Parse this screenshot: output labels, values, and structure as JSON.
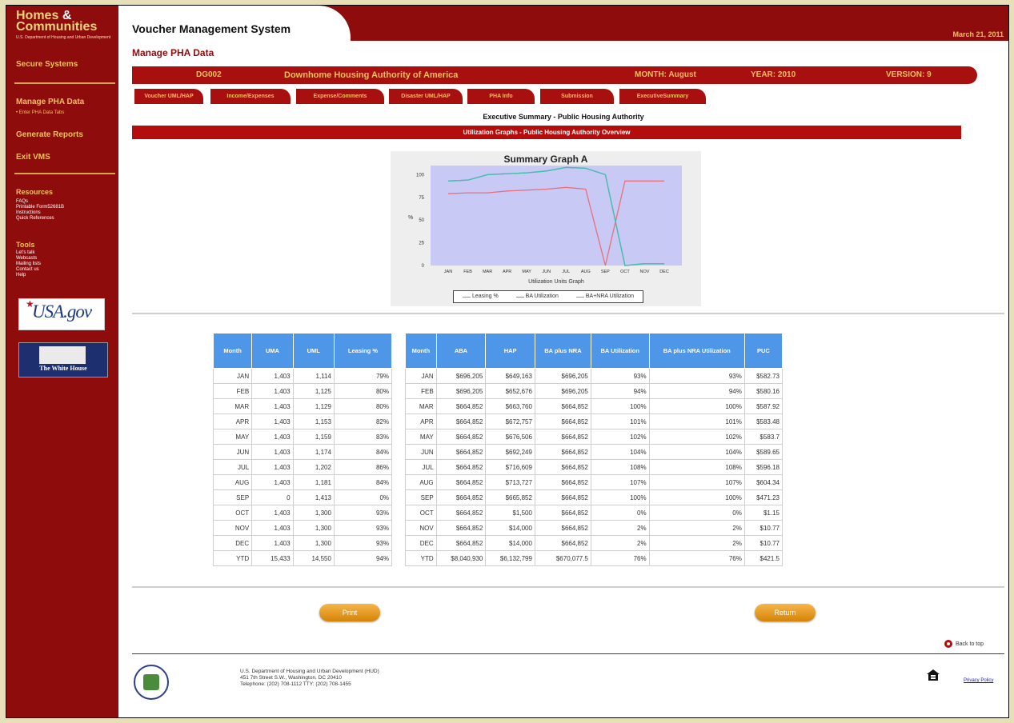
{
  "sidebar": {
    "logo_line1": "Homes",
    "logo_amp": "&",
    "logo_line2": "Communities",
    "logo_sub": "U.S. Department of Housing and Urban Development",
    "secure_systems": "Secure Systems",
    "manage_pha": "Manage PHA Data",
    "enter_pha_tabs": "• Enter PHA Data Tabs",
    "generate_reports": "Generate Reports",
    "exit_vms": "Exit VMS",
    "resources_heading": "Resources",
    "resources": [
      "FAQs",
      "Printable Form52681B",
      "Instructions",
      "Quick References"
    ],
    "tools_heading": "Tools",
    "tools": [
      "Let's talk",
      "Webcasts",
      "Mailing lists",
      "Contact us",
      "Help"
    ],
    "usa_gov": "USA.gov",
    "white_house": "The White House"
  },
  "header": {
    "app_title": "Voucher Management System",
    "date": "March 21, 2011",
    "page_title": "Manage PHA Data"
  },
  "info_bar": {
    "pha_code": "DG002",
    "pha_name": "Downhome Housing Authority of America",
    "month": "MONTH: August",
    "year": "YEAR: 2010",
    "version": "VERSION: 9"
  },
  "tabs": [
    "Voucher UML/HAP",
    "Income/Expenses",
    "Expense/Comments",
    "Disaster UML/HAP",
    "PHA Info",
    "Submission",
    "ExecutiveSummary"
  ],
  "section": {
    "title": "Executive Summary - Public Housing Authority",
    "subtitle": "Utilization Graphs - Public Housing Authority Overview"
  },
  "chart_data": {
    "type": "line",
    "title": "Summary Graph A",
    "xlabel": "Utilization Units Graph",
    "ylabel": "%",
    "categories": [
      "JAN",
      "FEB",
      "MAR",
      "APR",
      "MAY",
      "JUN",
      "JUL",
      "AUG",
      "SEP",
      "OCT",
      "NOV",
      "DEC"
    ],
    "ylim": [
      0,
      110
    ],
    "yticks": [
      0,
      25,
      50,
      75,
      100
    ],
    "series": [
      {
        "name": "Leasing %",
        "color": "#e8707a",
        "values": [
          79,
          80,
          80,
          82,
          83,
          84,
          86,
          84,
          0,
          93,
          93,
          93
        ]
      },
      {
        "name": "BA Utilization",
        "color": "#7f7fe0",
        "values": [
          93,
          94,
          100,
          101,
          102,
          104,
          108,
          107,
          100,
          0,
          2,
          2
        ]
      },
      {
        "name": "BA+NRA Utilization",
        "color": "#3fc4a4",
        "values": [
          93,
          94,
          100,
          101,
          102,
          104,
          108,
          107,
          100,
          0,
          2,
          2
        ]
      }
    ],
    "background": "#c9c9f5",
    "grid": false,
    "legend": "bottom"
  },
  "table_left": {
    "headers": [
      "Month",
      "UMA",
      "UML",
      "Leasing %"
    ],
    "rows": [
      [
        "JAN",
        "1,403",
        "1,114",
        "79%"
      ],
      [
        "FEB",
        "1,403",
        "1,125",
        "80%"
      ],
      [
        "MAR",
        "1,403",
        "1,129",
        "80%"
      ],
      [
        "APR",
        "1,403",
        "1,153",
        "82%"
      ],
      [
        "MAY",
        "1,403",
        "1,159",
        "83%"
      ],
      [
        "JUN",
        "1,403",
        "1,174",
        "84%"
      ],
      [
        "JUL",
        "1,403",
        "1,202",
        "86%"
      ],
      [
        "AUG",
        "1,403",
        "1,181",
        "84%"
      ],
      [
        "SEP",
        "0",
        "1,413",
        "0%"
      ],
      [
        "OCT",
        "1,403",
        "1,300",
        "93%"
      ],
      [
        "NOV",
        "1,403",
        "1,300",
        "93%"
      ],
      [
        "DEC",
        "1,403",
        "1,300",
        "93%"
      ],
      [
        "YTD",
        "15,433",
        "14,550",
        "94%"
      ]
    ]
  },
  "table_right": {
    "headers": [
      "Month",
      "ABA",
      "HAP",
      "BA plus NRA",
      "BA Utilization",
      "BA plus NRA Utilization",
      "PUC"
    ],
    "rows": [
      [
        "JAN",
        "$696,205",
        "$649,163",
        "$696,205",
        "93%",
        "93%",
        "$582.73"
      ],
      [
        "FEB",
        "$696,205",
        "$652,676",
        "$696,205",
        "94%",
        "94%",
        "$580.16"
      ],
      [
        "MAR",
        "$664,852",
        "$663,760",
        "$664,852",
        "100%",
        "100%",
        "$587.92"
      ],
      [
        "APR",
        "$664,852",
        "$672,757",
        "$664,852",
        "101%",
        "101%",
        "$583.48"
      ],
      [
        "MAY",
        "$664,852",
        "$676,506",
        "$664,852",
        "102%",
        "102%",
        "$583.7"
      ],
      [
        "JUN",
        "$664,852",
        "$692,249",
        "$664,852",
        "104%",
        "104%",
        "$589.65"
      ],
      [
        "JUL",
        "$664,852",
        "$716,609",
        "$664,852",
        "108%",
        "108%",
        "$596.18"
      ],
      [
        "AUG",
        "$664,852",
        "$713,727",
        "$664,852",
        "107%",
        "107%",
        "$604.34"
      ],
      [
        "SEP",
        "$664,852",
        "$665,852",
        "$664,852",
        "100%",
        "100%",
        "$471.23"
      ],
      [
        "OCT",
        "$664,852",
        "$1,500",
        "$664,852",
        "0%",
        "0%",
        "$1.15"
      ],
      [
        "NOV",
        "$664,852",
        "$14,000",
        "$664,852",
        "2%",
        "2%",
        "$10.77"
      ],
      [
        "DEC",
        "$664,852",
        "$14,000",
        "$664,852",
        "2%",
        "2%",
        "$10.77"
      ],
      [
        "YTD",
        "$8,040,930",
        "$6,132,799",
        "$670,077.5",
        "76%",
        "76%",
        "$421.5"
      ]
    ]
  },
  "buttons": {
    "print": "Print",
    "return": "Return"
  },
  "footer": {
    "back_to_top": "Back to top",
    "line1": "U.S. Department of Housing and Urban Development (HUD)",
    "line2": "451 7th Street S.W., Washington, DC 20410",
    "line3": "Telephone: (202) 708-1112  TTY: (202) 708-1455",
    "privacy": "Privacy Policy"
  }
}
